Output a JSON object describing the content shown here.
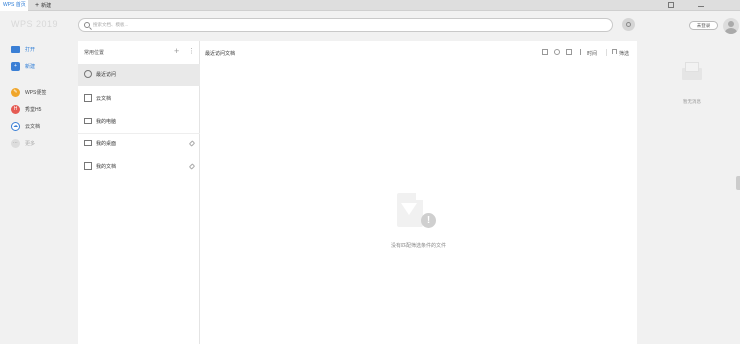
{
  "tabs": {
    "active_label": "WPS 首页",
    "new_label": "新建"
  },
  "header": {
    "logo": "WPS 2019",
    "search_placeholder": "搜索文档、模板...",
    "login_label": "未登录"
  },
  "nav": {
    "items": [
      {
        "label": "打开",
        "icon": "folder-open-icon"
      },
      {
        "label": "新建",
        "icon": "plus-icon"
      },
      {
        "label": "WPS便签",
        "icon": "note-icon"
      },
      {
        "label": "秀堂H5",
        "icon": "h5-icon"
      },
      {
        "label": "云文档",
        "icon": "cloud-icon"
      },
      {
        "label": "更多",
        "icon": "more-icon"
      }
    ]
  },
  "locations": {
    "header": "常用位置",
    "items": [
      {
        "label": "最近访问",
        "icon": "clock-icon"
      },
      {
        "label": "云文档",
        "icon": "cube-icon"
      },
      {
        "label": "我的电脑",
        "icon": "monitor-icon"
      },
      {
        "label": "我的桌面",
        "icon": "desktop-icon"
      },
      {
        "label": "我的文档",
        "icon": "documents-icon"
      }
    ]
  },
  "main": {
    "title": "最近访问文档",
    "time_label": "时间",
    "filter_label": "筛选",
    "empty_text": "没有匹配筛选条件的文件"
  },
  "right": {
    "empty_text": "暂无消息"
  }
}
